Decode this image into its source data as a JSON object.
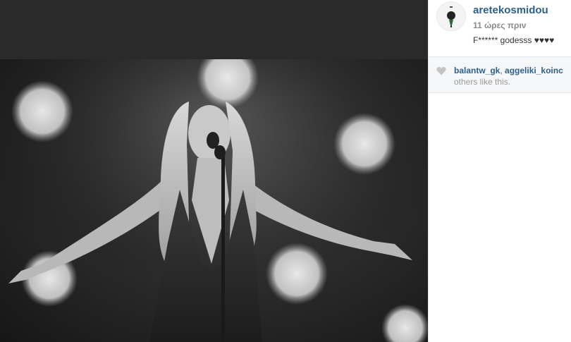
{
  "post": {
    "username": "aretekosmidou",
    "time_ago": "11 ώρες πριν",
    "caption": "F****** godesss ♥♥♥♥"
  },
  "likes": {
    "users": [
      "balantw_gk",
      "aggeliki_koinc"
    ],
    "separator": ",",
    "others_text": "others like this."
  },
  "icons": {
    "avatar": "profile-avatar",
    "like": "heart-icon"
  },
  "colors": {
    "username": "#2d5f8a",
    "top_bar": "#2a2a2a",
    "likes_background": "#f6f7f9"
  }
}
